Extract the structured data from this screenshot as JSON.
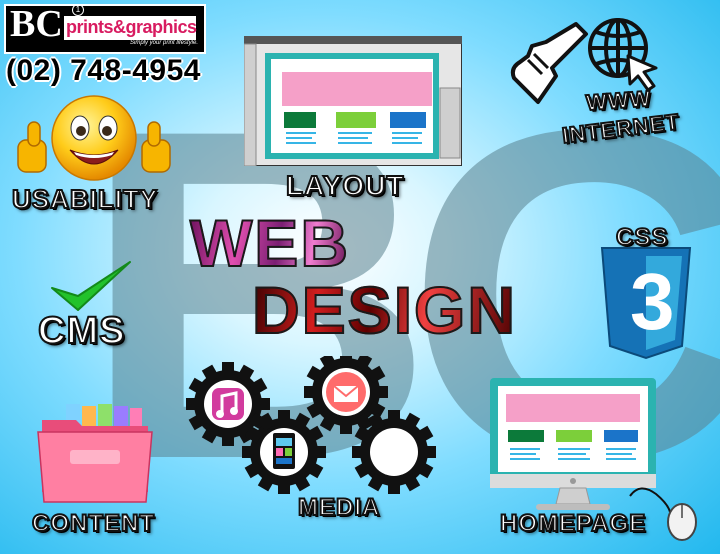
{
  "brand": {
    "logo_letters": "BC",
    "logo_mark": "1",
    "company": "prints&graphics",
    "slogan": "Simply your print lifestyle.",
    "phone": "(02) 748-4954"
  },
  "headline": {
    "line1": "WEB",
    "line2": "DESIGN"
  },
  "background_watermark": "BC",
  "features": {
    "usability": "USABILITY",
    "layout": "LAYOUT",
    "www": "WWW",
    "internet": "INTERNET",
    "css_badge": "CSS",
    "css_version": "3",
    "cms": "CMS",
    "content": "CONTENT",
    "media": "MEDIA",
    "homepage": "HOMEPAGE"
  },
  "colors": {
    "bg_edge": "#22b8ee",
    "bg_center": "#ffffff",
    "css_blue": "#1572b6",
    "check_green": "#22c22b",
    "wireframe_pink": "#f5a0c8",
    "wireframe_teal": "#2bb3b0"
  },
  "icons": [
    "smiley-thumbs-up-icon",
    "layout-wireframe-icon",
    "pointer-hand-icon",
    "globe-icon",
    "css3-shield-icon",
    "checkmark-icon",
    "folder-icon",
    "music-app-icon",
    "mail-icon",
    "tablet-icon",
    "gear-icon",
    "monitor-icon",
    "mouse-icon"
  ]
}
